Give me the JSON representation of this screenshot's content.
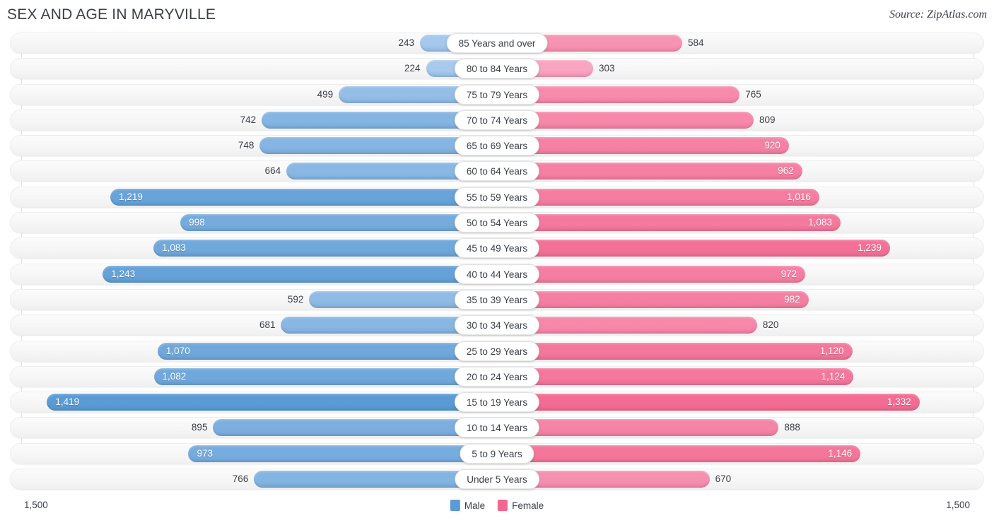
{
  "header": {
    "title": "SEX AND AGE IN MARYVILLE",
    "source": "Source: ZipAtlas.com"
  },
  "axis": {
    "left_max": "1,500",
    "right_max": "1,500"
  },
  "legend": {
    "male": {
      "label": "Male",
      "color": "#5b9bd5"
    },
    "female": {
      "label": "Female",
      "color": "#f2678f"
    }
  },
  "colors": {
    "male_light": "#a6c9ec",
    "male_dark": "#5b9bd5",
    "female_light": "#f9a8c4",
    "female_dark": "#f2678f",
    "track": "#f6f6f6",
    "text": "#3a3f47"
  },
  "chart_data": {
    "type": "bar",
    "title": "SEX AND AGE IN MARYVILLE",
    "subtitle": "",
    "xlabel": "",
    "ylabel": "",
    "orientation": "horizontal",
    "style": "population-pyramid",
    "axis_max": 1500,
    "xlim": [
      0,
      1500
    ],
    "grid": true,
    "legend_position": "bottom-center",
    "categories": [
      "85 Years and over",
      "80 to 84 Years",
      "75 to 79 Years",
      "70 to 74 Years",
      "65 to 69 Years",
      "60 to 64 Years",
      "55 to 59 Years",
      "50 to 54 Years",
      "45 to 49 Years",
      "40 to 44 Years",
      "35 to 39 Years",
      "30 to 34 Years",
      "25 to 29 Years",
      "20 to 24 Years",
      "15 to 19 Years",
      "10 to 14 Years",
      "5 to 9 Years",
      "Under 5 Years"
    ],
    "series": [
      {
        "name": "Male",
        "side": "left",
        "color": "#5b9bd5",
        "values": [
          243,
          224,
          499,
          742,
          748,
          664,
          1219,
          998,
          1083,
          1243,
          592,
          681,
          1070,
          1082,
          1419,
          895,
          973,
          766
        ]
      },
      {
        "name": "Female",
        "side": "right",
        "color": "#f2678f",
        "values": [
          584,
          303,
          765,
          809,
          920,
          962,
          1016,
          1083,
          1239,
          972,
          982,
          820,
          1120,
          1124,
          1332,
          888,
          1146,
          670
        ]
      }
    ]
  },
  "rows": [
    {
      "age": "85 Years and over",
      "male": 243,
      "male_label": "243",
      "female": 584,
      "female_label": "584"
    },
    {
      "age": "80 to 84 Years",
      "male": 224,
      "male_label": "224",
      "female": 303,
      "female_label": "303"
    },
    {
      "age": "75 to 79 Years",
      "male": 499,
      "male_label": "499",
      "female": 765,
      "female_label": "765"
    },
    {
      "age": "70 to 74 Years",
      "male": 742,
      "male_label": "742",
      "female": 809,
      "female_label": "809"
    },
    {
      "age": "65 to 69 Years",
      "male": 748,
      "male_label": "748",
      "female": 920,
      "female_label": "920"
    },
    {
      "age": "60 to 64 Years",
      "male": 664,
      "male_label": "664",
      "female": 962,
      "female_label": "962"
    },
    {
      "age": "55 to 59 Years",
      "male": 1219,
      "male_label": "1,219",
      "female": 1016,
      "female_label": "1,016"
    },
    {
      "age": "50 to 54 Years",
      "male": 998,
      "male_label": "998",
      "female": 1083,
      "female_label": "1,083"
    },
    {
      "age": "45 to 49 Years",
      "male": 1083,
      "male_label": "1,083",
      "female": 1239,
      "female_label": "1,239"
    },
    {
      "age": "40 to 44 Years",
      "male": 1243,
      "male_label": "1,243",
      "female": 972,
      "female_label": "972"
    },
    {
      "age": "35 to 39 Years",
      "male": 592,
      "male_label": "592",
      "female": 982,
      "female_label": "982"
    },
    {
      "age": "30 to 34 Years",
      "male": 681,
      "male_label": "681",
      "female": 820,
      "female_label": "820"
    },
    {
      "age": "25 to 29 Years",
      "male": 1070,
      "male_label": "1,070",
      "female": 1120,
      "female_label": "1,120"
    },
    {
      "age": "20 to 24 Years",
      "male": 1082,
      "male_label": "1,082",
      "female": 1124,
      "female_label": "1,124"
    },
    {
      "age": "15 to 19 Years",
      "male": 1419,
      "male_label": "1,419",
      "female": 1332,
      "female_label": "1,332"
    },
    {
      "age": "10 to 14 Years",
      "male": 895,
      "male_label": "895",
      "female": 888,
      "female_label": "888"
    },
    {
      "age": "5 to 9 Years",
      "male": 973,
      "male_label": "973",
      "female": 1146,
      "female_label": "1,146"
    },
    {
      "age": "Under 5 Years",
      "male": 766,
      "male_label": "766",
      "female": 670,
      "female_label": "670"
    }
  ]
}
